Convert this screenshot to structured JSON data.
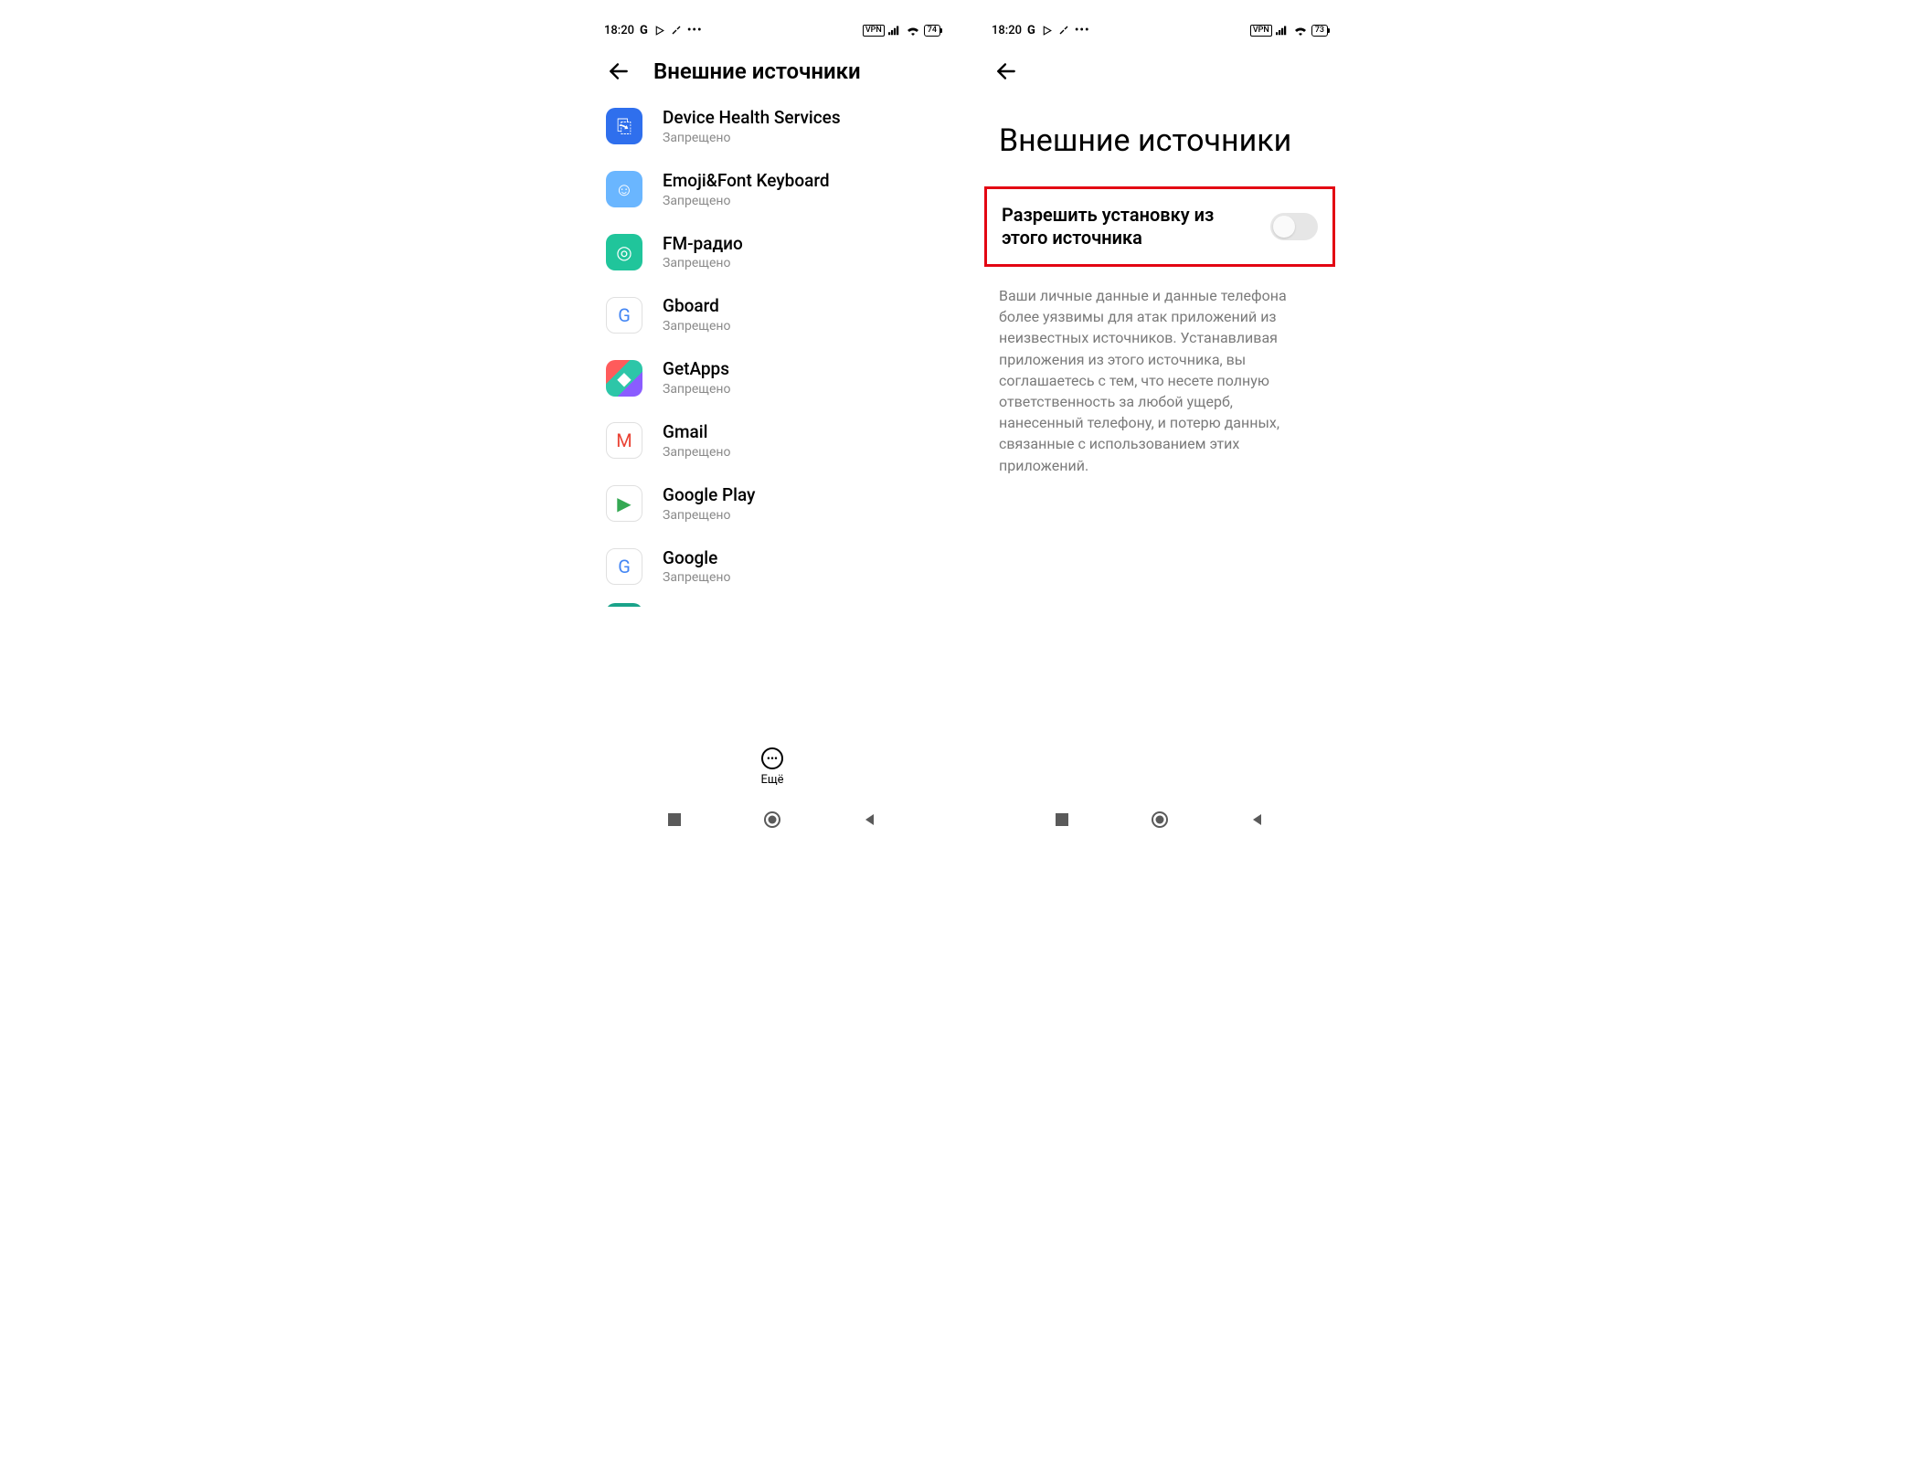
{
  "left": {
    "status": {
      "time": "18:20",
      "vpn": "VPN",
      "battery": "74"
    },
    "header": {
      "title": "Внешние источники"
    },
    "apps": [
      {
        "name": "Device Health Services",
        "status": "Запрещено",
        "iconBg": "#2f6fed",
        "iconFg": "#fff",
        "glyph": "⎘"
      },
      {
        "name": "Emoji&Font Keyboard",
        "status": "Запрещено",
        "iconBg": "#6ab6ff",
        "iconFg": "#fff",
        "glyph": "☺"
      },
      {
        "name": "FM-радио",
        "status": "Запрещено",
        "iconBg": "#20c59b",
        "iconFg": "#fff",
        "glyph": "◎"
      },
      {
        "name": "Gboard",
        "status": "Запрещено",
        "iconBg": "#ffffff",
        "iconFg": "#4285F4",
        "glyph": "G",
        "border": true
      },
      {
        "name": "GetApps",
        "status": "Запрещено",
        "iconBg": "#ffffff",
        "iconFg": "#000",
        "glyph": "◆",
        "multicolor": true
      },
      {
        "name": "Gmail",
        "status": "Запрещено",
        "iconBg": "#ffffff",
        "iconFg": "#ea4335",
        "glyph": "M",
        "border": true
      },
      {
        "name": "Google Play",
        "status": "Запрещено",
        "iconBg": "#ffffff",
        "iconFg": "#34a853",
        "glyph": "▶",
        "border": true
      },
      {
        "name": "Google",
        "status": "Запрещено",
        "iconBg": "#ffffff",
        "iconFg": "#4285F4",
        "glyph": "G",
        "border": true
      }
    ],
    "more": {
      "label": "Ещё"
    }
  },
  "right": {
    "status": {
      "time": "18:20",
      "vpn": "VPN",
      "battery": "73"
    },
    "title": "Внешние источники",
    "toggle": {
      "label": "Разрешить установку из этого источника",
      "on": false
    },
    "description": "Ваши личные данные и данные телефона более уязвимы для атак приложений из неизвестных источников. Устанавливая приложения из этого источника, вы соглашаетесь с тем, что несете полную ответственность за любой ущерб, нанесенный телефону, и потерю данных, связанные с использованием этих приложений."
  }
}
